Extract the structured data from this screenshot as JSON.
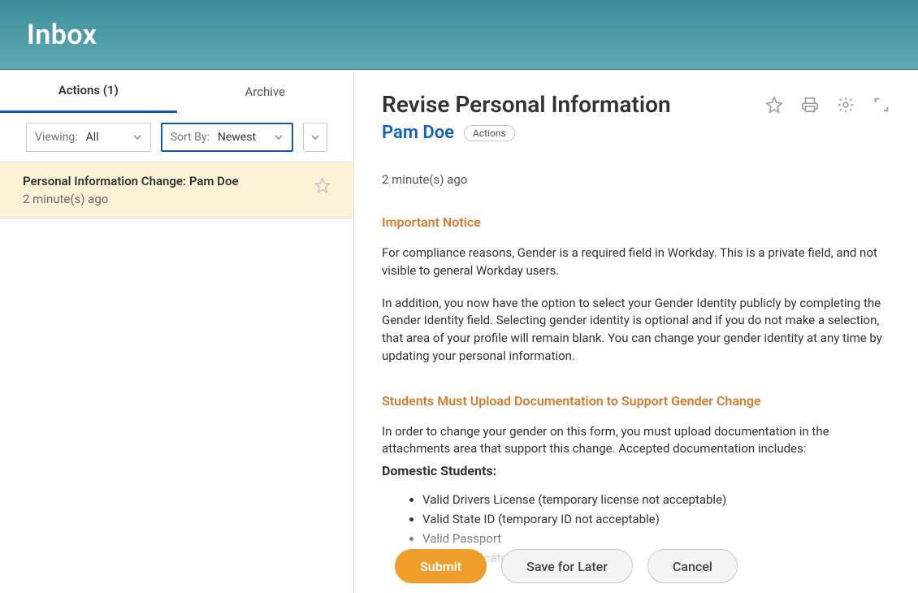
{
  "header": {
    "title": "Inbox"
  },
  "tabs": {
    "actions": "Actions (1)",
    "archive": "Archive"
  },
  "filters": {
    "viewing_label": "Viewing:",
    "viewing_value": "All",
    "sort_label": "Sort By:",
    "sort_value": "Newest"
  },
  "inbox": [
    {
      "title": "Personal Information Change: Pam Doe",
      "time": "2 minute(s) ago"
    }
  ],
  "detail": {
    "title": "Revise Personal Information",
    "person": "Pam Doe",
    "actions_label": "Actions",
    "time": "2 minute(s) ago",
    "notice_heading": "Important Notice",
    "notice_p1": "For compliance reasons, Gender is a required field in Workday. This is a private field, and not visible to general Workday users.",
    "notice_p2": "In addition, you now have the option to select your Gender Identity publicly by completing the Gender Identity field. Selecting gender identity is optional and if you do not make a selection, that area of your profile will remain blank. You can change your gender identity at any time by updating your personal information.",
    "doc_heading": "Students Must Upload Documentation to Support Gender Change",
    "doc_p1": "In order to change your gender on this form, you must upload documentation in the attachments area that support this change. Accepted documentation includes:",
    "domestic_heading": "Domestic Students:",
    "domestic_docs": [
      "Valid Drivers License (temporary license not acceptable)",
      "Valid State ID (temporary ID not acceptable)",
      "Valid Passport",
      "Birth Certificate"
    ]
  },
  "buttons": {
    "submit": "Submit",
    "save": "Save for Later",
    "cancel": "Cancel"
  }
}
